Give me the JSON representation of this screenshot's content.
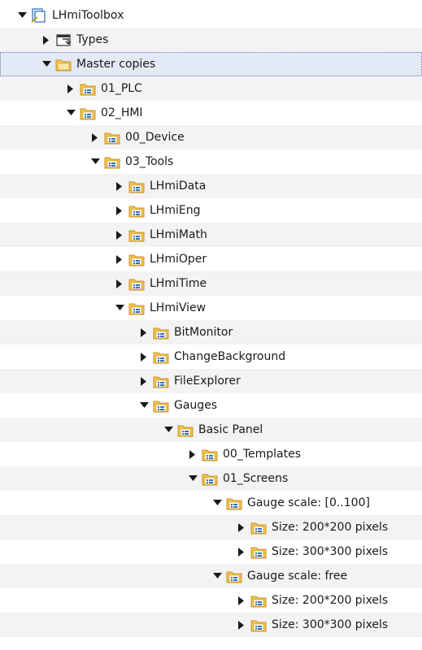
{
  "tree": {
    "items": [
      {
        "label": "LHmiToolbox",
        "depth": 0,
        "expanded": true,
        "icon": "library-icon"
      },
      {
        "label": "Types",
        "depth": 1,
        "expanded": false,
        "icon": "types-icon"
      },
      {
        "label": "Master copies",
        "depth": 1,
        "expanded": true,
        "icon": "master-copies-folder-icon",
        "selected": true
      },
      {
        "label": "01_PLC",
        "depth": 2,
        "expanded": false,
        "icon": "folder-icon"
      },
      {
        "label": "02_HMI",
        "depth": 2,
        "expanded": true,
        "icon": "folder-icon"
      },
      {
        "label": "00_Device",
        "depth": 3,
        "expanded": false,
        "icon": "folder-icon"
      },
      {
        "label": "03_Tools",
        "depth": 3,
        "expanded": true,
        "icon": "folder-icon"
      },
      {
        "label": "LHmiData",
        "depth": 4,
        "expanded": false,
        "icon": "folder-icon"
      },
      {
        "label": "LHmiEng",
        "depth": 4,
        "expanded": false,
        "icon": "folder-icon"
      },
      {
        "label": "LHmiMath",
        "depth": 4,
        "expanded": false,
        "icon": "folder-icon"
      },
      {
        "label": "LHmiOper",
        "depth": 4,
        "expanded": false,
        "icon": "folder-icon"
      },
      {
        "label": "LHmiTime",
        "depth": 4,
        "expanded": false,
        "icon": "folder-icon"
      },
      {
        "label": "LHmiView",
        "depth": 4,
        "expanded": true,
        "icon": "folder-icon"
      },
      {
        "label": "BitMonitor",
        "depth": 5,
        "expanded": false,
        "icon": "folder-icon"
      },
      {
        "label": "ChangeBackground",
        "depth": 5,
        "expanded": false,
        "icon": "folder-icon"
      },
      {
        "label": "FileExplorer",
        "depth": 5,
        "expanded": false,
        "icon": "folder-icon"
      },
      {
        "label": "Gauges",
        "depth": 5,
        "expanded": true,
        "icon": "folder-icon"
      },
      {
        "label": "Basic Panel",
        "depth": 6,
        "expanded": true,
        "icon": "folder-icon"
      },
      {
        "label": "00_Templates",
        "depth": 7,
        "expanded": false,
        "icon": "folder-icon"
      },
      {
        "label": "01_Screens",
        "depth": 7,
        "expanded": true,
        "icon": "folder-icon"
      },
      {
        "label": "Gauge scale: [0..100]",
        "depth": 8,
        "expanded": true,
        "icon": "folder-icon"
      },
      {
        "label": "Size: 200*200 pixels",
        "depth": 9,
        "expanded": false,
        "icon": "folder-icon"
      },
      {
        "label": "Size: 300*300 pixels",
        "depth": 9,
        "expanded": false,
        "icon": "folder-icon"
      },
      {
        "label": "Gauge scale: free",
        "depth": 8,
        "expanded": true,
        "icon": "folder-icon"
      },
      {
        "label": "Size: 200*200 pixels",
        "depth": 9,
        "expanded": false,
        "icon": "folder-icon"
      },
      {
        "label": "Size: 300*300 pixels",
        "depth": 9,
        "expanded": false,
        "icon": "folder-icon"
      }
    ]
  },
  "colors": {
    "folder_yellow": "#f2c24a",
    "folder_border": "#c8962a",
    "folder_mark": "#2f6fb8",
    "selection_bg": "#e2e8f4",
    "selection_border": "#5f7fb5",
    "stripe_bg": "#f3f3f4"
  }
}
